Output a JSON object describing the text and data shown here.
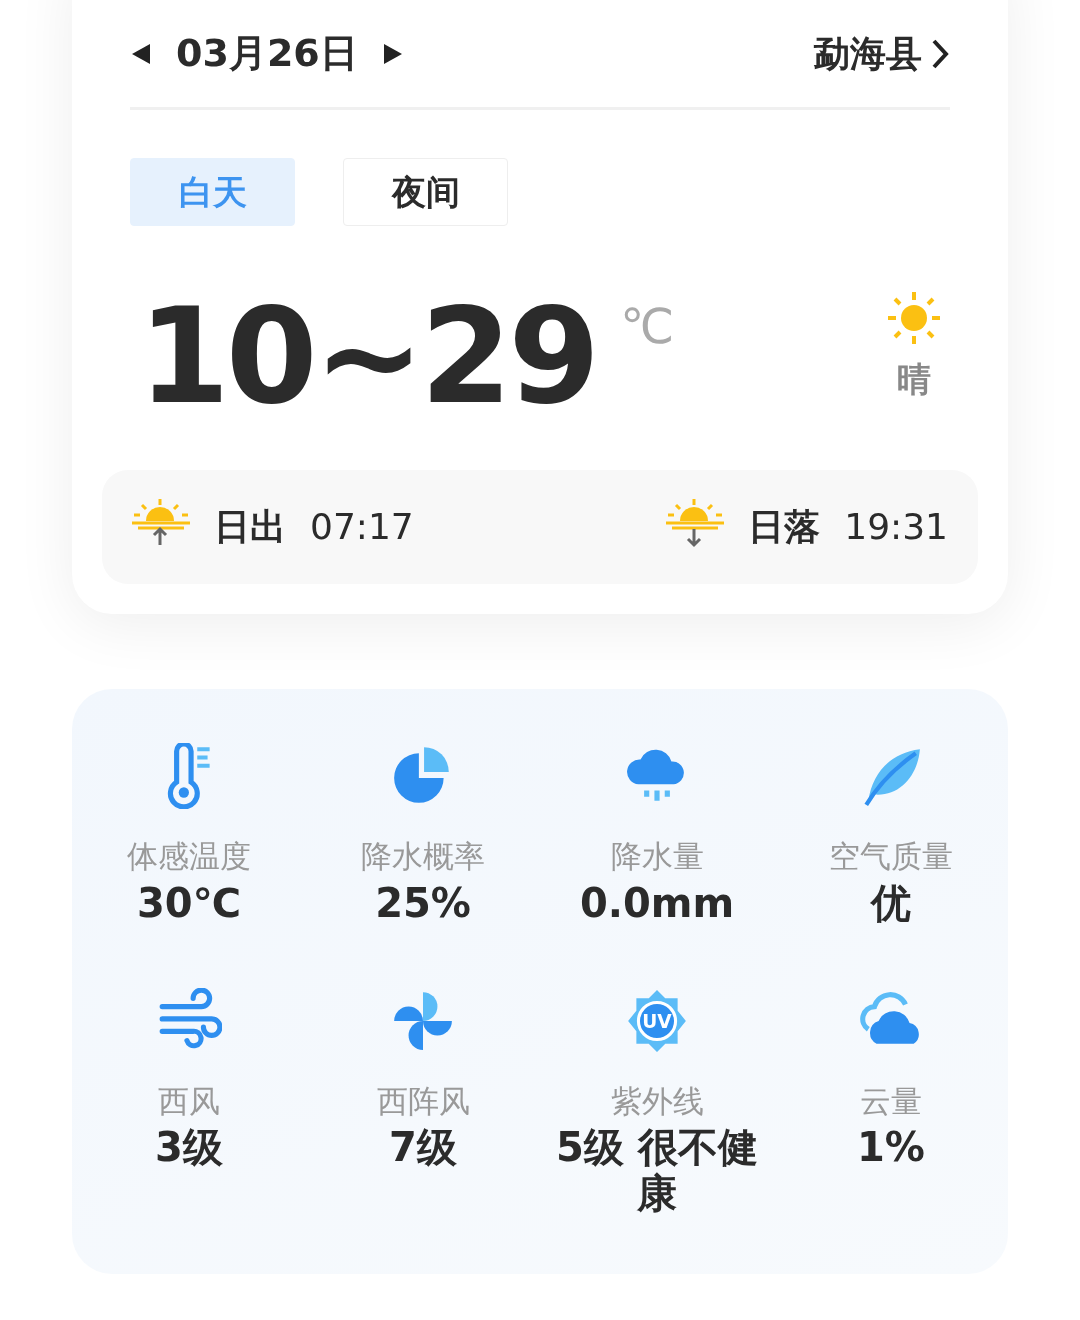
{
  "header": {
    "date": "03月26日",
    "location": "勐海县"
  },
  "tabs": [
    {
      "label": "白天",
      "selected": true
    },
    {
      "label": "夜间",
      "selected": false
    }
  ],
  "temperature": {
    "range": "10~29",
    "unit": "℃",
    "condition": "晴"
  },
  "sun": [
    {
      "kind": "sunrise",
      "label": "日出",
      "time": "07:17"
    },
    {
      "kind": "sunset",
      "label": "日落",
      "time": "19:31"
    }
  ],
  "metrics": [
    {
      "kind": "thermometer",
      "label": "体感温度",
      "value": "30℃"
    },
    {
      "kind": "pie",
      "label": "降水概率",
      "value": "25%"
    },
    {
      "kind": "rain",
      "label": "降水量",
      "value": "0.0mm"
    },
    {
      "kind": "leaf",
      "label": "空气质量",
      "value": "优"
    },
    {
      "kind": "wind",
      "label": "西风",
      "value": "3级"
    },
    {
      "kind": "fan",
      "label": "西阵风",
      "value": "7级"
    },
    {
      "kind": "uv",
      "label": "紫外线",
      "value": "5级 很不健康",
      "icon_text": "UV"
    },
    {
      "kind": "cloud",
      "label": "云量",
      "value": "1%"
    }
  ]
}
